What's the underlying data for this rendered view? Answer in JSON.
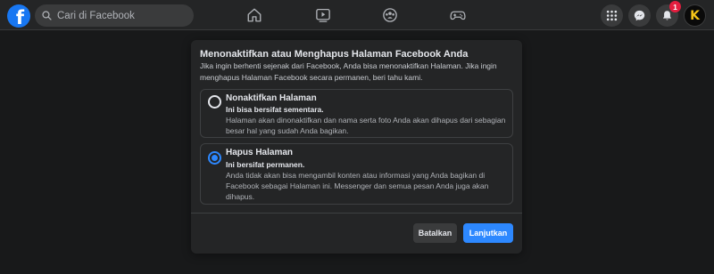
{
  "header": {
    "logo_letter": "f",
    "search_placeholder": "Cari di Facebook",
    "nav_icons": [
      "home-icon",
      "watch-icon",
      "groups-icon",
      "gaming-icon"
    ],
    "notification_count": "1",
    "avatar_letter": "K"
  },
  "modal": {
    "title": "Menonaktifkan atau Menghapus Halaman Facebook Anda",
    "description": "Jika ingin berhenti sejenak dari Facebook, Anda bisa menonaktifkan Halaman. Jika ingin menghapus Halaman Facebook secara permanen, beri tahu kami.",
    "options": [
      {
        "title": "Nonaktifkan Halaman",
        "subtitle": "Ini bisa bersifat sementara.",
        "body": "Halaman akan dinonaktifkan dan nama serta foto Anda akan dihapus dari sebagian besar hal yang sudah Anda bagikan.",
        "selected": false
      },
      {
        "title": "Hapus Halaman",
        "subtitle": "Ini bersifat permanen.",
        "body": "Anda tidak akan bisa mengambil konten atau informasi yang Anda bagikan di Facebook sebagai Halaman ini. Messenger dan semua pesan Anda juga akan dihapus.",
        "selected": true
      }
    ],
    "cancel_label": "Batalkan",
    "continue_label": "Lanjutkan"
  },
  "colors": {
    "accent": "#2d88ff",
    "background": "#18191a",
    "surface": "#242526",
    "brand": "#1877f2",
    "badge": "#e41e3f"
  }
}
